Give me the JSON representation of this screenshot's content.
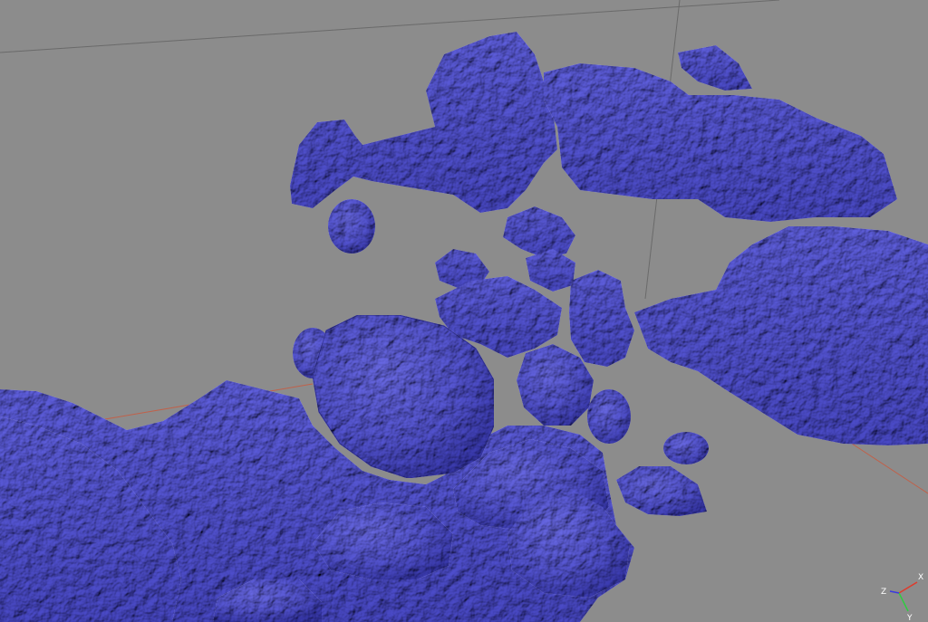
{
  "viewport": {
    "background_color": "#8c8c8c",
    "mesh_color": "#8f8fe6",
    "mesh_shadow_color": "#5a5ab0",
    "mesh_highlight_color": "#b8b8f5",
    "grid_color": "#6e6e6e",
    "x_axis_color": "#d4573f"
  },
  "axes_widget": {
    "x_label": "X",
    "y_label": "Y",
    "z_label": "Z",
    "x_color": "#e03a2a",
    "y_color": "#2ecc40",
    "z_color": "#3a3adf"
  }
}
